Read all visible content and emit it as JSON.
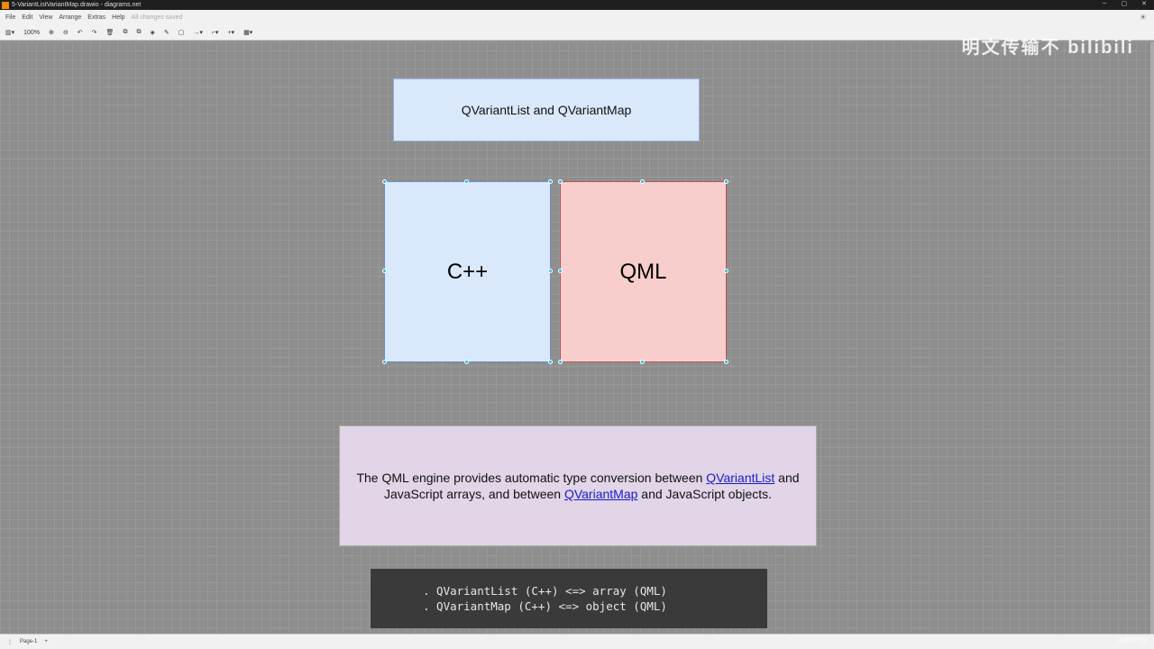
{
  "window": {
    "title": "5-VariantListVariantMap.drawio - diagrams.net",
    "minimize": "–",
    "maximize": "▢",
    "close": "✕"
  },
  "menu": {
    "items": [
      "File",
      "Edit",
      "View",
      "Arrange",
      "Extras",
      "Help"
    ],
    "status": "All changes saved"
  },
  "toolbar": {
    "zoom": "100%"
  },
  "diagram": {
    "title": "QVariantList and QVariantMap",
    "cpp": "C++",
    "qml": "QML",
    "desc_pre": "The QML engine provides automatic type conversion between ",
    "link1": "QVariantList",
    "desc_mid": " and JavaScript arrays, and between ",
    "link2": "QVariantMap",
    "desc_post": " and JavaScript objects.",
    "code": [
      ". QVariantList (C++) <=> array (QML)",
      ". QVariantMap (C++) <=> object (QML)"
    ]
  },
  "watermark": "明文传输不 bilibili",
  "pages": {
    "current": "Page-1",
    "add": "+",
    "menu": "⋮"
  },
  "udemy": "üdemy"
}
